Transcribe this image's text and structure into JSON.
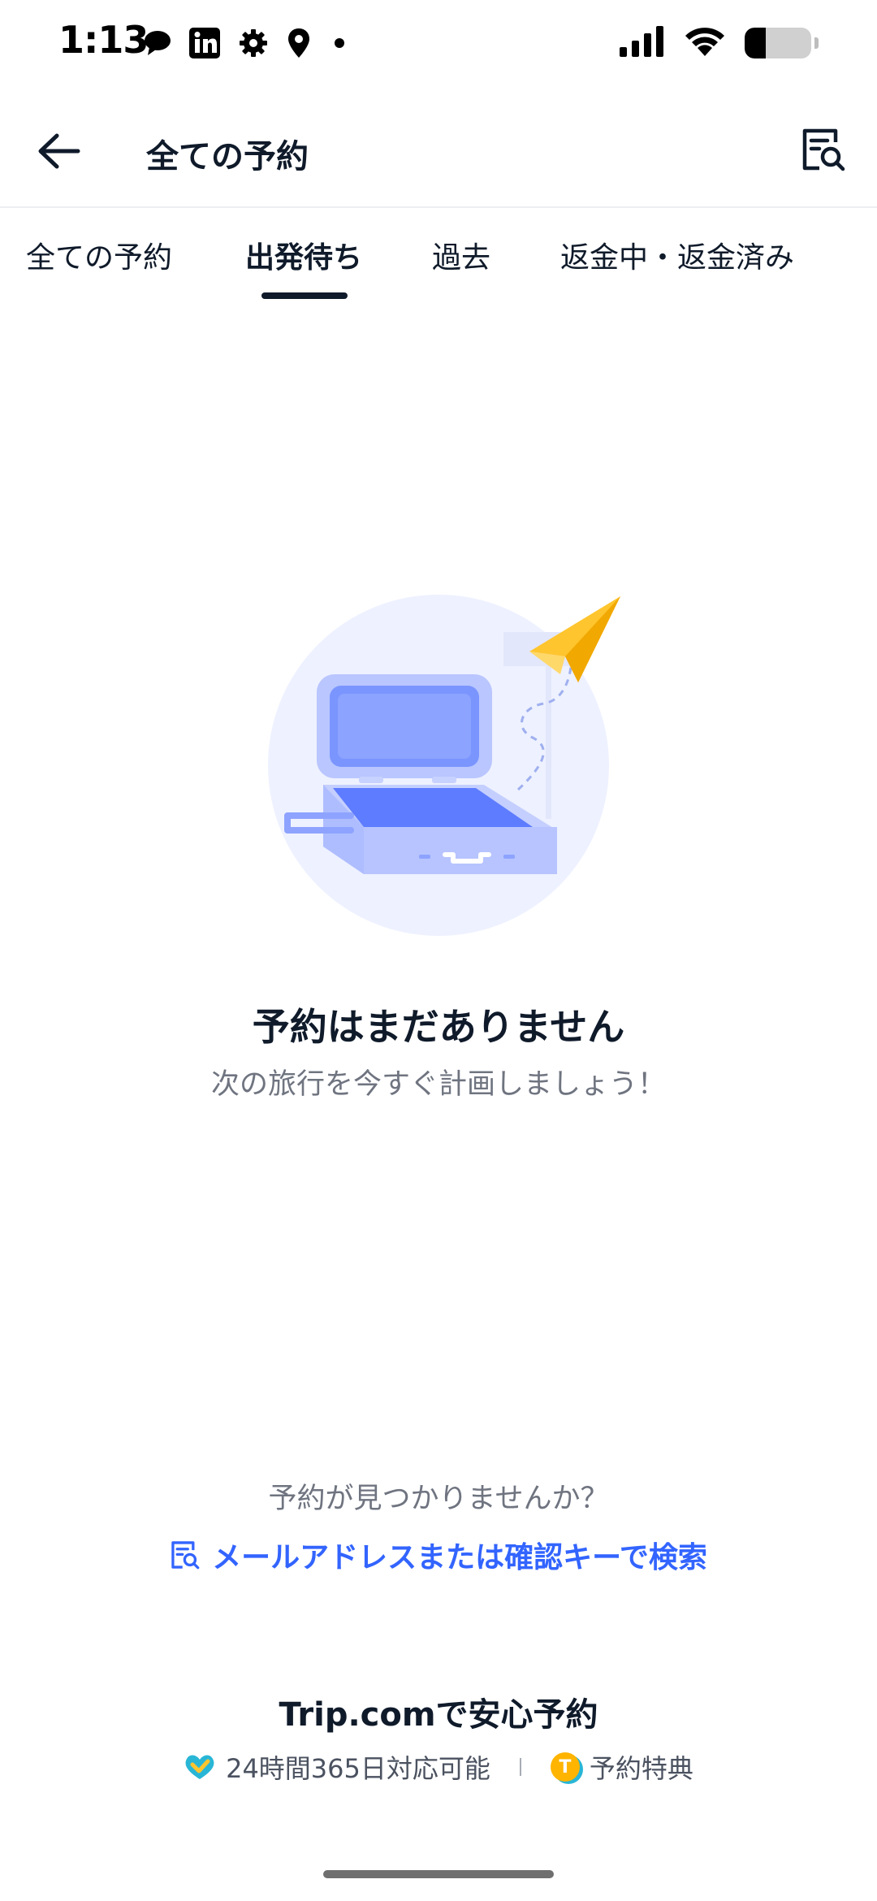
{
  "status_bar": {
    "time": "1:13",
    "battery_level": 0.32
  },
  "header": {
    "title": "全ての予約"
  },
  "tabs": [
    {
      "label": "全ての予約",
      "active": false
    },
    {
      "label": "出発待ち",
      "active": true
    },
    {
      "label": "過去",
      "active": false
    },
    {
      "label": "返金中・返金済み",
      "active": false
    }
  ],
  "empty_state": {
    "title": "予約はまだありません",
    "subtitle": "次の旅行を今すぐ計画しましょう！"
  },
  "lookup": {
    "question": "予約が見つかりませんか？",
    "link_label": "メールアドレスまたは確認キーで検索"
  },
  "assurance": {
    "title": "Trip.comで安心予約",
    "items": [
      {
        "label": "24時間365日対応可能",
        "icon": "heart-check-icon"
      },
      {
        "label": "予約特典",
        "icon": "trip-coin-icon"
      }
    ]
  },
  "colors": {
    "accent": "#3264ff",
    "text": "#0f1a2a",
    "muted": "#6f7480",
    "illustration_bg": "#eef1ff"
  }
}
